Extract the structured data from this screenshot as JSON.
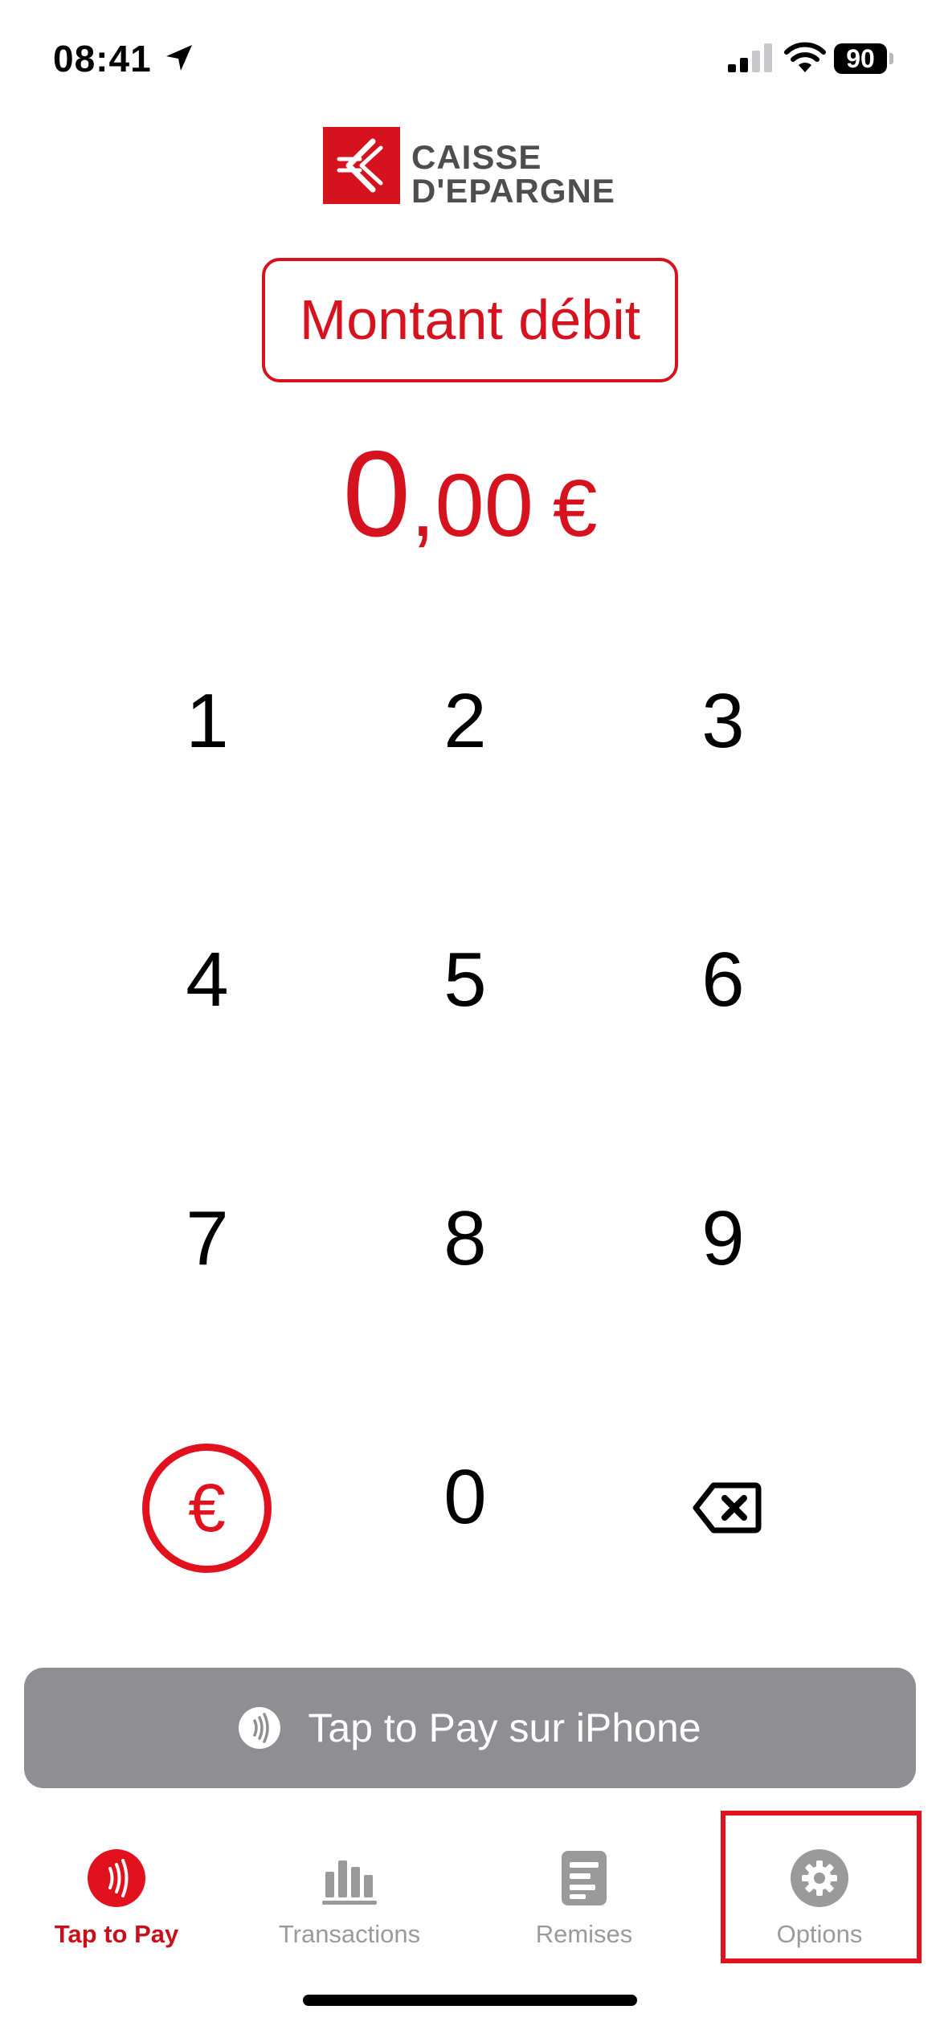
{
  "status_bar": {
    "time": "08:41",
    "battery": "90"
  },
  "logo": {
    "line1": "CAISSE",
    "line2": "D'EPARGNE",
    "brand_color": "#d5121d"
  },
  "mode_badge": {
    "label": "Montant débit"
  },
  "amount": {
    "integer": "0",
    "decimals": ",00",
    "currency": "€"
  },
  "keypad": {
    "keys": [
      "1",
      "2",
      "3",
      "4",
      "5",
      "6",
      "7",
      "8",
      "9",
      "0"
    ],
    "euro_key": "€",
    "backspace_icon": "backspace-icon"
  },
  "pay_button": {
    "label": "Tap to Pay sur iPhone",
    "icon": "contactless-icon"
  },
  "tabs": [
    {
      "label": "Tap to Pay",
      "icon": "contactless-icon",
      "active": true
    },
    {
      "label": "Transactions",
      "icon": "bar-chart-icon",
      "active": false
    },
    {
      "label": "Remises",
      "icon": "document-icon",
      "active": false
    },
    {
      "label": "Options",
      "icon": "gear-icon",
      "active": false
    }
  ],
  "colors": {
    "accent": "#d5121d",
    "button_disabled": "#8e8e93",
    "tab_inactive": "#9a9a9a"
  }
}
